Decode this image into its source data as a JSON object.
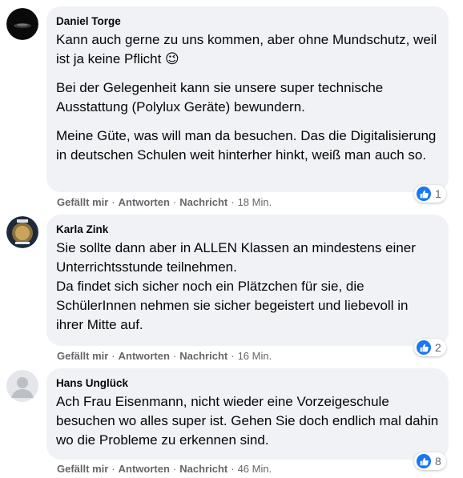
{
  "actions": {
    "like": "Gefällt mir",
    "reply": "Antworten",
    "message": "Nachricht"
  },
  "comments": [
    {
      "author": "Daniel Torge",
      "paragraphs": [
        "Kann auch gerne zu uns kommen, aber ohne Mundschutz, weil ist ja keine Pflicht 😉",
        "Bei der Gelegenheit kann sie unsere super technische Ausstattung (Polylux Geräte) bewundern.",
        "Meine Güte, was will man da besuchen. Das die Digitalisierung in deutschen Schulen weit hinterher hinkt, weiß man auch so."
      ],
      "time": "18 Min.",
      "reactions": "1"
    },
    {
      "author": "Karla Zink",
      "paragraphs": [
        "Sie sollte dann aber in ALLEN Klassen an mindestens einer Unterrichtsstunde teilnehmen.",
        "Da findet sich sicher noch ein Plätzchen für sie, die SchülerInnen nehmen sie sicher begeistert und liebevoll in ihrer Mitte auf."
      ],
      "time": "16 Min.",
      "reactions": "2"
    },
    {
      "author": "Hans Unglück",
      "paragraphs": [
        "Ach Frau Eisenmann, nicht wieder eine Vorzeigeschule besuchen wo alles super ist. Gehen Sie doch endlich mal dahin wo die Probleme zu erkennen sind."
      ],
      "time": "46 Min.",
      "reactions": "8"
    }
  ],
  "colors": {
    "bubble": "#f0f2f5",
    "like_blue": "#1877f2",
    "meta_text": "#65676b"
  },
  "icons": {
    "reaction": "thumbs-up-icon",
    "default_avatar": "default-avatar-icon"
  }
}
